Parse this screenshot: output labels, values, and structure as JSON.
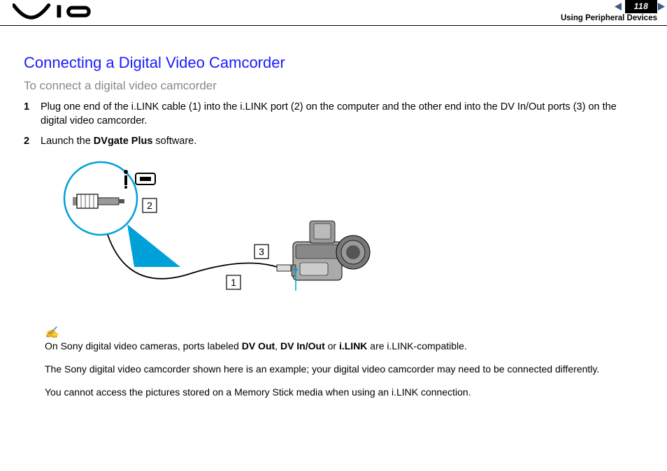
{
  "header": {
    "page_number": "118",
    "section": "Using Peripheral Devices"
  },
  "title": "Connecting a Digital Video Camcorder",
  "subtitle": "To connect a digital video camcorder",
  "steps": [
    {
      "num": "1",
      "text_pre": "Plug one end of the i.LINK cable (1) into the i.LINK port (2) on the computer and the other end into the DV In/Out ports (3) on the digital video camcorder."
    },
    {
      "num": "2",
      "text_pre": "Launch the ",
      "bold": "DVgate Plus",
      "text_post": " software."
    }
  ],
  "callouts": {
    "c1": "1",
    "c2": "2",
    "c3": "3"
  },
  "notes": {
    "n1_pre": "On Sony digital video cameras, ports labeled ",
    "n1_b1": "DV Out",
    "n1_sep1": ", ",
    "n1_b2": "DV In/Out",
    "n1_sep2": " or ",
    "n1_b3": "i.LINK",
    "n1_post": " are i.LINK-compatible.",
    "n2": "The Sony digital video camcorder shown here is an example; your digital video camcorder may need to be connected differently.",
    "n3": "You cannot access the pictures stored on a Memory Stick media when using an i.LINK connection."
  }
}
